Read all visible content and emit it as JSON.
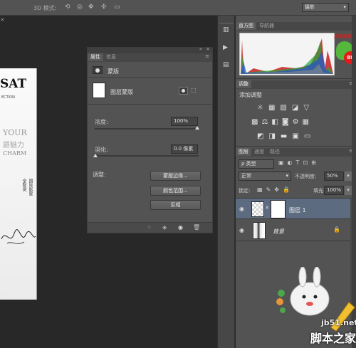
{
  "options_bar": {
    "mode3d_label": "3D 模式:",
    "workspace": "摄影"
  },
  "document": {
    "logo": "SAT",
    "sub": "ECTION",
    "line1": "YOUR",
    "line2": "爵魅力",
    "line3": "CHARM",
    "footer_line1": "国际影星",
    "footer_line2": "全智贤"
  },
  "properties": {
    "tabs": [
      "属性",
      "信息"
    ],
    "section": "蒙版",
    "item": "图层蒙版",
    "density_label": "浓度:",
    "density_value": "100%",
    "feather_label": "羽化:",
    "feather_value": "0.0 像素",
    "adjust_label": "调整:",
    "buttons": [
      "蒙版边缘...",
      "颜色范围...",
      "反相"
    ]
  },
  "right": {
    "histogram_tabs": [
      "直方图",
      "导航器"
    ],
    "badge": "点我加速",
    "badge_num": "88",
    "adjust_tab": "调整",
    "adjust_title": "添加调整",
    "layers_tabs": [
      "图层",
      "通道",
      "路径"
    ],
    "filter_label": "ρ 类型",
    "blend_mode": "正常",
    "opacity_label": "不透明度:",
    "opacity_value": "50%",
    "lock_label": "锁定:",
    "fill_label": "填充:",
    "fill_value": "100%",
    "layers": [
      {
        "name": "图层 1"
      },
      {
        "name": "背景"
      }
    ]
  },
  "watermark": {
    "site": "jb51.net",
    "cn": "脚本之家"
  },
  "colors": {
    "panel": "#535353",
    "selected_layer": "#5d6b80",
    "badge_red": "#e21b1b"
  }
}
